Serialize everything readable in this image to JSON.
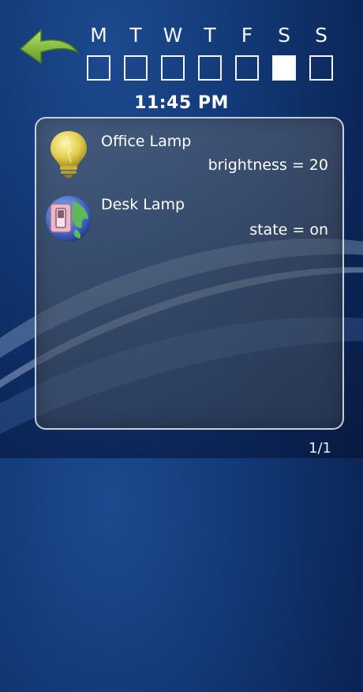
{
  "days": [
    {
      "letter": "M",
      "selected": false
    },
    {
      "letter": "T",
      "selected": false
    },
    {
      "letter": "W",
      "selected": false
    },
    {
      "letter": "T",
      "selected": false
    },
    {
      "letter": "F",
      "selected": false
    },
    {
      "letter": "S",
      "selected": true
    },
    {
      "letter": "S",
      "selected": false
    }
  ],
  "time": "11:45 PM",
  "devices": [
    {
      "name": "Office Lamp",
      "status": "brightness = 20",
      "icon": "light-bulb-icon"
    },
    {
      "name": "Desk Lamp",
      "status": "state = on",
      "icon": "switch-globe-icon"
    }
  ],
  "page_indicator": "1/1",
  "icons": {
    "back": "back-arrow-icon"
  },
  "colors": {
    "back_arrow": "#7fbf3a",
    "selected_day": "#ffffff",
    "bulb": "#d8c24a"
  }
}
